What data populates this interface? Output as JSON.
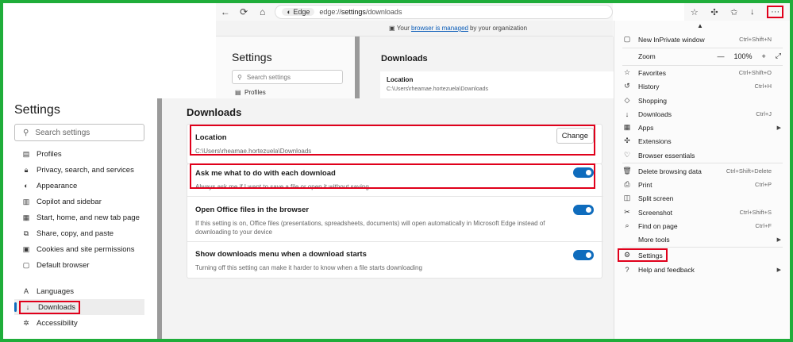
{
  "browser": {
    "site_pill": "Edge",
    "url_prefix": "edge://",
    "url_bold": "settings",
    "url_suffix": "/downloads",
    "more_label": "···",
    "managed_pre": "Your",
    "managed_link": "browser is managed",
    "managed_post": "by your organization"
  },
  "bg": {
    "title": "Settings",
    "search_placeholder": "Search settings",
    "profiles": "Profiles",
    "main_title": "Downloads",
    "location_label": "Location",
    "location_path": "C:\\Users\\rheamae.hortezuela\\Downloads"
  },
  "sidebar": {
    "title": "Settings",
    "search_placeholder": "Search settings",
    "items": [
      {
        "label": "Profiles"
      },
      {
        "label": "Privacy, search, and services"
      },
      {
        "label": "Appearance"
      },
      {
        "label": "Copilot and sidebar"
      },
      {
        "label": "Start, home, and new tab page"
      },
      {
        "label": "Share, copy, and paste"
      },
      {
        "label": "Cookies and site permissions"
      },
      {
        "label": "Default browser"
      },
      {
        "label": "Languages"
      },
      {
        "label": "Downloads"
      },
      {
        "label": "Accessibility"
      }
    ]
  },
  "main": {
    "title": "Downloads",
    "location_label": "Location",
    "location_path": "C:\\Users\\rheamae.hortezuela\\Downloads",
    "change_label": "Change",
    "ask_title": "Ask me what to do with each download",
    "ask_desc": "Always ask me if I want to save a file or open it without saving",
    "office_title": "Open Office files in the browser",
    "office_desc": "If this setting is on, Office files (presentations, spreadsheets, documents) will open automatically in Microsoft Edge instead of downloading to your device",
    "menu_title": "Show downloads menu when a download starts",
    "menu_desc": "Turning off this setting can make it harder to know when a file starts downloading"
  },
  "menu": {
    "new_inprivate": {
      "label": "New InPrivate window",
      "shortcut": "Ctrl+Shift+N"
    },
    "zoom": {
      "label": "Zoom",
      "value": "100%"
    },
    "favorites": {
      "label": "Favorites",
      "shortcut": "Ctrl+Shift+O"
    },
    "history": {
      "label": "History",
      "shortcut": "Ctrl+H"
    },
    "shopping": {
      "label": "Shopping"
    },
    "downloads": {
      "label": "Downloads",
      "shortcut": "Ctrl+J"
    },
    "apps": {
      "label": "Apps"
    },
    "extensions": {
      "label": "Extensions"
    },
    "essentials": {
      "label": "Browser essentials"
    },
    "delete_data": {
      "label": "Delete browsing data",
      "shortcut": "Ctrl+Shift+Delete"
    },
    "print": {
      "label": "Print",
      "shortcut": "Ctrl+P"
    },
    "split": {
      "label": "Split screen"
    },
    "screenshot": {
      "label": "Screenshot",
      "shortcut": "Ctrl+Shift+S"
    },
    "find": {
      "label": "Find on page",
      "shortcut": "Ctrl+F"
    },
    "more_tools": {
      "label": "More tools"
    },
    "settings": {
      "label": "Settings"
    },
    "help": {
      "label": "Help and feedback"
    }
  }
}
